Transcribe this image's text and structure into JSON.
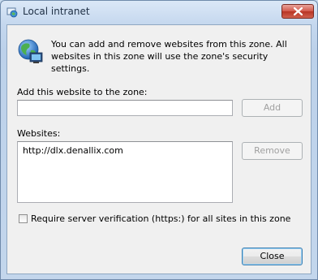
{
  "window": {
    "title": "Local intranet"
  },
  "description": "You can add and remove websites from this zone. All websites in this zone will use the zone's security settings.",
  "add_section": {
    "label": "Add this website to the zone:",
    "input_value": "",
    "add_button": "Add"
  },
  "websites_section": {
    "label": "Websites:",
    "items": [
      "http://dlx.denallix.com"
    ],
    "remove_button": "Remove"
  },
  "verification": {
    "label": "Require server verification (https:) for all sites in this zone",
    "checked": false
  },
  "footer": {
    "close_button": "Close"
  },
  "icons": {
    "app": "intranet-globe-icon",
    "zone": "globe-network-icon",
    "close": "close-x-icon"
  },
  "colors": {
    "titlebar": "#c4d7ee",
    "close_button": "#c7402f",
    "dialog_bg": "#f0f0f0"
  }
}
